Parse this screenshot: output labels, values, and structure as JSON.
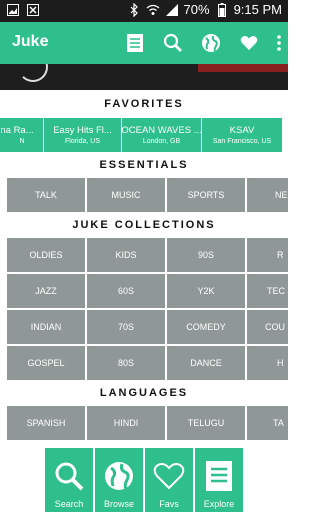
{
  "status": {
    "battery": "70%",
    "time": "9:15 PM"
  },
  "app": {
    "title": "Juke"
  },
  "sections": {
    "favorites": "FAVORITES",
    "essentials": "ESSENTIALS",
    "collections": "JUKE COLLECTIONS",
    "languages": "LANGUAGES"
  },
  "favorites": [
    {
      "name": "na Ra...",
      "location": "N"
    },
    {
      "name": "Easy Hits Fl...",
      "location": "Florida, US"
    },
    {
      "name": "OCEAN WAVES ...",
      "location": "London, GB"
    },
    {
      "name": "KSAV",
      "location": "San Francisco, US"
    }
  ],
  "essentials": [
    "TALK",
    "MUSIC",
    "SPORTS",
    "NE"
  ],
  "collections": [
    [
      "OLDIES",
      "KIDS",
      "90S",
      "R"
    ],
    [
      "JAZZ",
      "60S",
      "Y2K",
      "TEC"
    ],
    [
      "INDIAN",
      "70S",
      "COMEDY",
      "COU"
    ],
    [
      "GOSPEL",
      "80S",
      "DANCE",
      "H"
    ]
  ],
  "languages": [
    "SPANISH",
    "HINDI",
    "TELUGU",
    "TA"
  ],
  "nav": [
    {
      "label": "Search",
      "icon": "search-icon"
    },
    {
      "label": "Browse",
      "icon": "globe-icon"
    },
    {
      "label": "Favs",
      "icon": "heart-icon"
    },
    {
      "label": "Explore",
      "icon": "explore-icon"
    }
  ],
  "colors": {
    "accent": "#2fbf8c",
    "tile": "#909897",
    "statusbar": "#1c1c1c"
  }
}
